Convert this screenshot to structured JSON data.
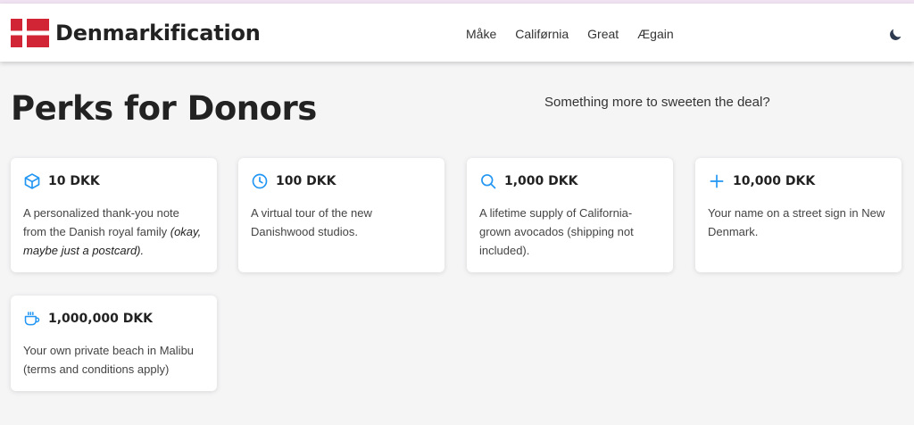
{
  "navbar": {
    "brand": "Denmarkification",
    "links": [
      "Måke",
      "Califørnia",
      "Great",
      "Ægain"
    ],
    "theme_icon": "moon-icon",
    "flag_colors": {
      "red": "#d12536",
      "white": "#ffffff"
    }
  },
  "page": {
    "title": "Perks for Donors",
    "subtitle": "Something more to sweeten the deal?"
  },
  "accent_color": "#2196f3",
  "perks": [
    {
      "icon": "cube-icon",
      "amount": "10 DKK",
      "text": "A personalized thank-you note from the Danish royal family",
      "note": "(okay, maybe just a postcard)."
    },
    {
      "icon": "clock-icon",
      "amount": "100 DKK",
      "text": "A virtual tour of the new Danishwood studios.",
      "note": ""
    },
    {
      "icon": "search-icon",
      "amount": "1,000 DKK",
      "text": "A lifetime supply of California-grown avocados (shipping not included).",
      "note": ""
    },
    {
      "icon": "plus-icon",
      "amount": "10,000 DKK",
      "text": "Your name on a street sign in New Denmark.",
      "note": ""
    },
    {
      "icon": "coffee-cup-icon",
      "amount": "1,000,000 DKK",
      "text": "Your own private beach in Malibu (terms and conditions apply)",
      "note": ""
    }
  ]
}
